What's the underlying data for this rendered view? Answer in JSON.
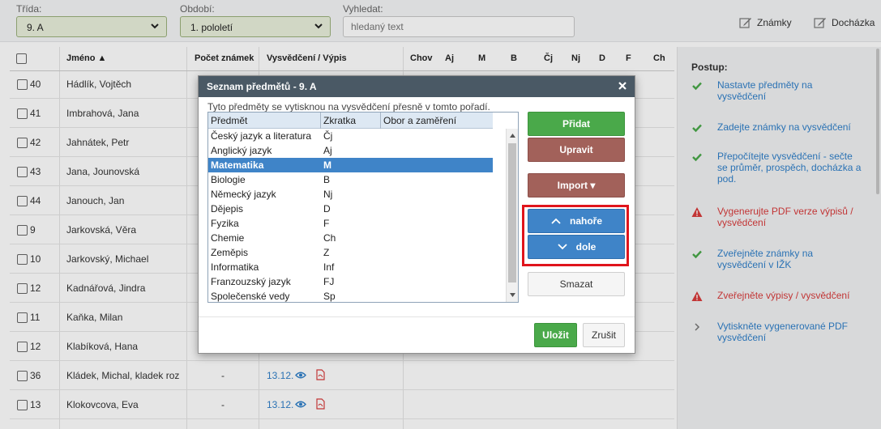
{
  "filters": {
    "class_label": "Třída:",
    "class_value": "9. A",
    "period_label": "Období:",
    "period_value": "1. pololetí",
    "search_label": "Vyhledat:",
    "search_placeholder": "hledaný text"
  },
  "top_actions": {
    "grades": "Známky",
    "attendance": "Docházka"
  },
  "table": {
    "headers": {
      "name": "Jméno ▲",
      "count": "Počet známek",
      "report": "Vysvědčení / Výpis",
      "subjects": [
        "Chov",
        "Aj",
        "M",
        "B",
        "Čj",
        "Nj",
        "D",
        "F",
        "Ch"
      ]
    },
    "rows": [
      {
        "num": "40",
        "name": "Hádlík, Vojtěch",
        "count": "",
        "date": ""
      },
      {
        "num": "41",
        "name": "Imbrahová, Jana",
        "count": "",
        "date": ""
      },
      {
        "num": "42",
        "name": "Jahnátek, Petr",
        "count": "",
        "date": ""
      },
      {
        "num": "43",
        "name": "Jana, Jounovská",
        "count": "",
        "date": ""
      },
      {
        "num": "44",
        "name": "Janouch, Jan",
        "count": "",
        "date": ""
      },
      {
        "num": "9",
        "name": "Jarkovská, Věra",
        "count": "",
        "date": ""
      },
      {
        "num": "10",
        "name": "Jarkovský, Michael",
        "count": "",
        "date": ""
      },
      {
        "num": "12",
        "name": "Kadnářová, Jindra",
        "count": "",
        "date": ""
      },
      {
        "num": "11",
        "name": "Kaňka, Milan",
        "count": "",
        "date": ""
      },
      {
        "num": "12",
        "name": "Klabíková, Hana",
        "count": "",
        "date": ""
      },
      {
        "num": "36",
        "name": "Kládek, Michal, kladek roz",
        "count": "-",
        "date": "13.12."
      },
      {
        "num": "13",
        "name": "Klokovcova, Eva",
        "count": "-",
        "date": "13.12."
      }
    ]
  },
  "steps": {
    "title": "Postup:",
    "items": [
      {
        "status": "ok",
        "text": "Nastavte předměty na vysvědčení"
      },
      {
        "status": "ok",
        "text": "Zadejte známky na vysvědčení"
      },
      {
        "status": "ok",
        "text": "Přepočítejte vysvědčení - sečte se průměr, prospěch, docházka a pod."
      },
      {
        "status": "warn",
        "text": "Vygenerujte PDF verze výpisů / vysvědčení"
      },
      {
        "status": "ok",
        "text": "Zveřejněte známky na vysvědčení v IŽK"
      },
      {
        "status": "warn",
        "text": "Zveřejněte výpisy / vysvědčení"
      },
      {
        "status": "next",
        "text": "Vytiskněte vygenerované PDF vysvědčení"
      }
    ]
  },
  "modal": {
    "title": "Seznam předmětů - 9. A",
    "description": "Tyto předměty se vytisknou na vysvědčení přesně v tomto pořadí.",
    "columns": [
      "Předmět",
      "Zkratka",
      "Obor a zaměření"
    ],
    "subjects": [
      {
        "name": "Český jazyk a literatura",
        "abbr": "Čj"
      },
      {
        "name": "Anglický jazyk",
        "abbr": "Aj"
      },
      {
        "name": "Matematika",
        "abbr": "M",
        "selected": true
      },
      {
        "name": "Biologie",
        "abbr": "B"
      },
      {
        "name": "Německý jazyk",
        "abbr": "Nj"
      },
      {
        "name": "Dějepis",
        "abbr": "D"
      },
      {
        "name": "Fyzika",
        "abbr": "F"
      },
      {
        "name": "Chemie",
        "abbr": "Ch"
      },
      {
        "name": "Zeměpis",
        "abbr": "Z"
      },
      {
        "name": "Informatika",
        "abbr": "Inf"
      },
      {
        "name": "Franzouzský jazyk",
        "abbr": "FJ"
      },
      {
        "name": "Společenské vedy",
        "abbr": "Sp"
      }
    ],
    "buttons": {
      "add": "Přidat",
      "edit": "Upravit",
      "import": "Import ▾",
      "up": "nahoře",
      "down": "dole",
      "delete": "Smazat",
      "save": "Uložit",
      "cancel": "Zrušit"
    }
  },
  "colors": {
    "accent_blue": "#3f84c8",
    "ok_green": "#4aa94a",
    "warn_red": "#d83c3c",
    "highlight_red": "#e0141c",
    "header_dark": "#4a5965"
  }
}
